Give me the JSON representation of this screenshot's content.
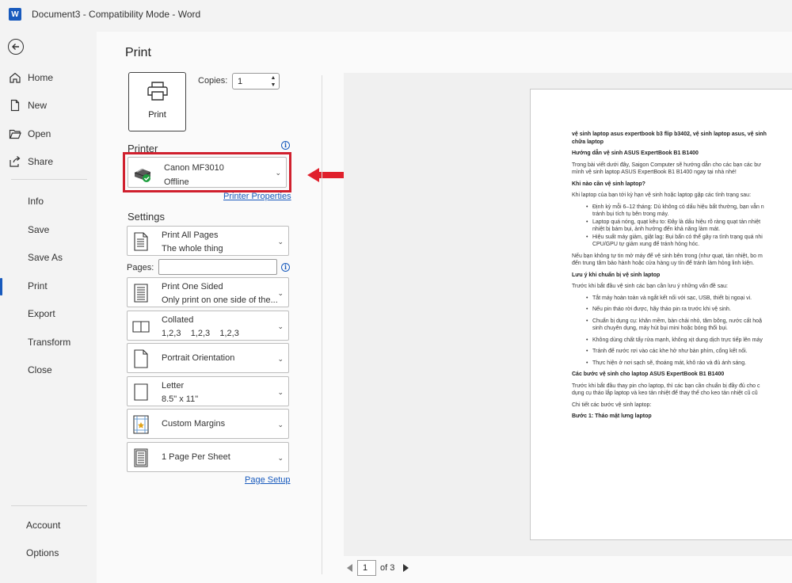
{
  "window": {
    "title": "Document3  -  Compatibility Mode  -  Word",
    "app_badge": "W"
  },
  "nav": {
    "items": [
      {
        "label": "Home"
      },
      {
        "label": "New"
      },
      {
        "label": "Open"
      },
      {
        "label": "Share"
      },
      {
        "label": "Info"
      },
      {
        "label": "Save"
      },
      {
        "label": "Save As"
      },
      {
        "label": "Print"
      },
      {
        "label": "Export"
      },
      {
        "label": "Transform"
      },
      {
        "label": "Close"
      }
    ],
    "bottom": [
      {
        "label": "Account"
      },
      {
        "label": "Options"
      }
    ]
  },
  "print": {
    "heading": "Print",
    "button_label": "Print",
    "copies_label": "Copies:",
    "copies_value": "1",
    "printer_section": "Printer",
    "printer_name": "Canon MF3010",
    "printer_status": "Offline",
    "printer_properties": "Printer Properties",
    "settings_section": "Settings",
    "pages_label": "Pages:",
    "pages_value": "",
    "page_setup": "Page Setup",
    "settings": [
      {
        "line1": "Print All Pages",
        "line2": "The whole thing"
      },
      {
        "line1": "Print One Sided",
        "line2": "Only print on one side of the..."
      },
      {
        "line1": "Collated",
        "line2": "1,2,3    1,2,3    1,2,3"
      },
      {
        "line1": "Portrait Orientation"
      },
      {
        "line1": "Letter",
        "line2": "8.5\" x 11\""
      },
      {
        "line1": "Custom Margins"
      },
      {
        "line1": "1 Page Per Sheet"
      }
    ]
  },
  "preview": {
    "current_page": "1",
    "of_pages": "of 3",
    "lines": [
      {
        "t": "vệ sinh laptop asus expertbook b3 flip b3402, vệ sinh laptop asus, vệ sinh",
        "k": "h"
      },
      {
        "t": "chữa laptop",
        "k": "h"
      },
      {
        "t": "",
        "k": "gap"
      },
      {
        "t": "Hướng dẫn vệ sinh ASUS ExpertBook B1 B1400",
        "k": "h"
      },
      {
        "t": "",
        "k": "gap"
      },
      {
        "t": "Trong bài viết dưới đây, Saigon Computer sẽ hướng dẫn cho các bạn các bư",
        "k": "p"
      },
      {
        "t": "mình vệ sinh laptop ASUS ExpertBook B1 B1400 ngay tại nhà nhé!",
        "k": "p"
      },
      {
        "t": "",
        "k": "gap"
      },
      {
        "t": "Khi nào cần vệ sinh laptop?",
        "k": "h"
      },
      {
        "t": "",
        "k": "gap"
      },
      {
        "t": "Khi laptop của bạn tới kỳ hạn vệ sinh hoặc laptop gặp các tình trạng sau:",
        "k": "p"
      },
      {
        "t": "",
        "k": "gap"
      },
      {
        "t": "Định kỳ mỗi 6–12 tháng: Dù không có dấu hiệu bất thường, bạn vẫn n",
        "k": "li"
      },
      {
        "t": "tránh bụi tích tụ bên trong máy.",
        "k": "lic"
      },
      {
        "t": "Laptop quá nóng, quạt kêu to: Đây là dấu hiệu rõ ràng quạt tản nhiệt",
        "k": "li"
      },
      {
        "t": "nhiệt bị bám bụi, ảnh hưởng đến khả năng làm mát.",
        "k": "lic"
      },
      {
        "t": "Hiệu suất máy giảm, giật lag: Bụi bẩn có thể gây ra tình trạng quá nhi",
        "k": "li"
      },
      {
        "t": "CPU/GPU tự giảm xung để tránh hỏng hóc.",
        "k": "lic"
      },
      {
        "t": "",
        "k": "gap"
      },
      {
        "t": "Nếu bạn không tự tin mở máy để vệ sinh bên trong (như quạt, tản nhiệt, bo m",
        "k": "p"
      },
      {
        "t": "đến trung tâm bảo hành hoặc cửa hàng uy tín để tránh làm hỏng linh kiện.",
        "k": "p"
      },
      {
        "t": "",
        "k": "gap"
      },
      {
        "t": "Lưu ý khi chuẩn bị vệ sinh laptop",
        "k": "h"
      },
      {
        "t": "",
        "k": "gap"
      },
      {
        "t": "Trước khi bắt đầu vệ sinh các bạn cần lưu ý những vấn đề sau:",
        "k": "p"
      },
      {
        "t": "",
        "k": "gap"
      },
      {
        "t": "Tắt máy hoàn toàn và ngắt kết nối với sạc, USB, thiết bị ngoại vi.",
        "k": "li"
      },
      {
        "t": "",
        "k": "gap"
      },
      {
        "t": "Nếu pin tháo rời được, hãy tháo pin ra trước khi vệ sinh.",
        "k": "li"
      },
      {
        "t": "",
        "k": "gap"
      },
      {
        "t": "Chuẩn bị dụng cụ: khăn mềm, bàn chải nhỏ, tăm bông, nước cất hoặ",
        "k": "li"
      },
      {
        "t": "sinh chuyên dụng, máy hút bụi mini hoặc bóng thổi bụi.",
        "k": "lic"
      },
      {
        "t": "",
        "k": "gap"
      },
      {
        "t": "Không dùng chất tẩy rửa mạnh, không xịt dung dịch trực tiếp lên máy",
        "k": "li"
      },
      {
        "t": "",
        "k": "gap"
      },
      {
        "t": "Tránh để nước rơi vào các khe hở như bàn phím, cổng kết nối.",
        "k": "li"
      },
      {
        "t": "",
        "k": "gap"
      },
      {
        "t": "Thực hiện ở nơi sạch sẽ, thoáng mát, khô ráo và đủ ánh sáng.",
        "k": "li"
      },
      {
        "t": "",
        "k": "gap"
      },
      {
        "t": "Các bước vệ sinh cho laptop ASUS ExpertBook B1 B1400",
        "k": "h"
      },
      {
        "t": "",
        "k": "gap"
      },
      {
        "t": "Trước khi bắt đầu thay pin cho laptop, thì các bạn cần chuẩn bị đầy đủ cho c",
        "k": "p"
      },
      {
        "t": "dụng cụ tháo lắp laptop và keo tản nhiệt để thay thế cho keo tản nhiệt cũ cũ",
        "k": "p"
      },
      {
        "t": "",
        "k": "gap"
      },
      {
        "t": "Chi tiết các bước vệ sinh laptop:",
        "k": "p"
      },
      {
        "t": "",
        "k": "gap"
      },
      {
        "t": "Bước 1: Tháo mặt lưng laptop",
        "k": "h"
      }
    ]
  },
  "colors": {
    "accent": "#185abd",
    "highlight": "#d0202e",
    "status_ok": "#1e9e3e"
  }
}
